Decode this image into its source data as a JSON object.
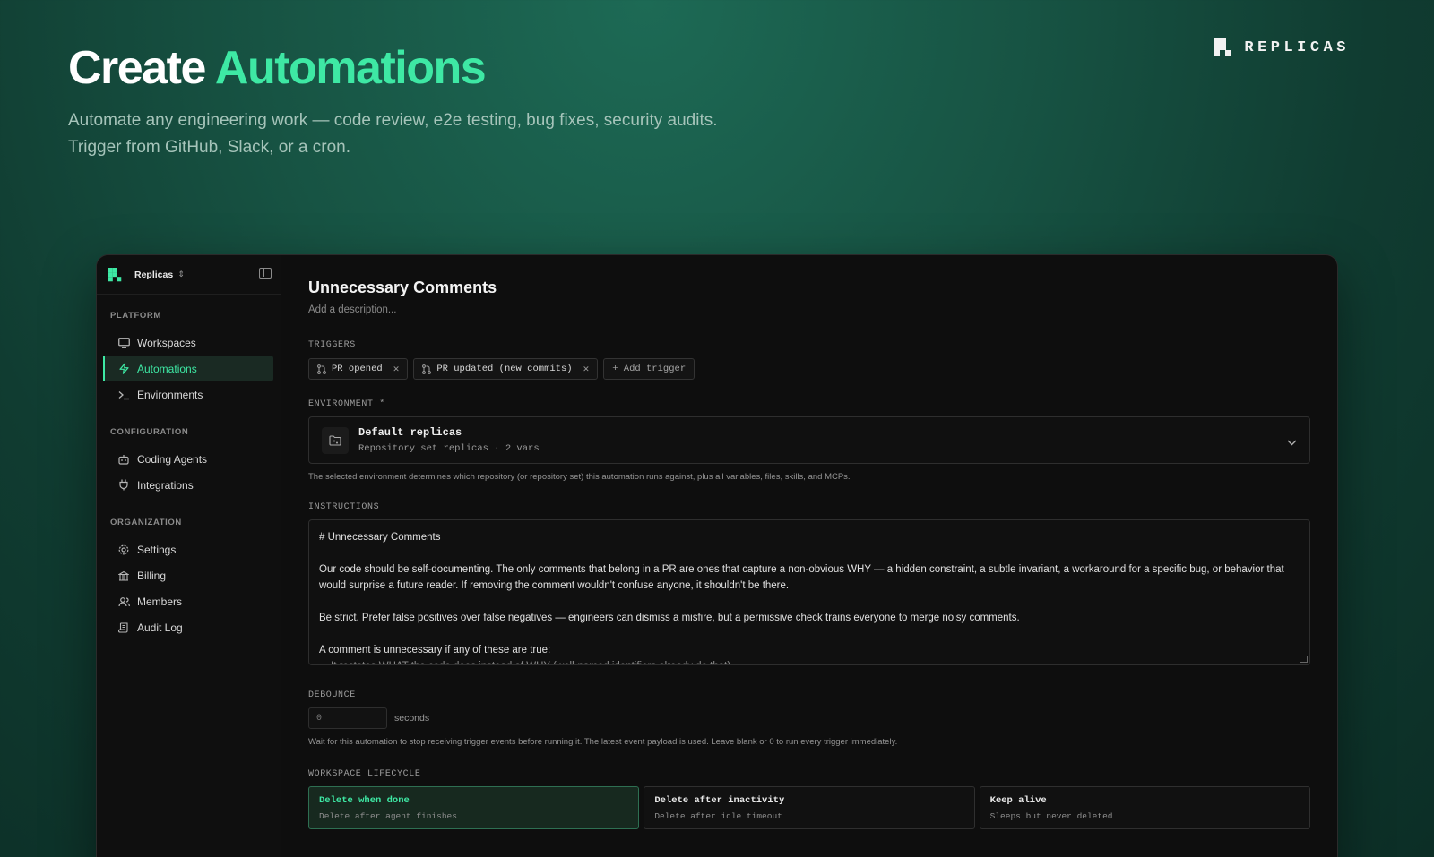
{
  "hero": {
    "title_plain": "Create",
    "title_accent": "Automations",
    "subtitle_line1": "Automate any engineering work — code review, e2e testing, bug fixes, security audits.",
    "subtitle_line2": "Trigger from GitHub, Slack, or a cron."
  },
  "brand": {
    "name": "REPLICAS",
    "logo_icon": "replicas-logo-icon"
  },
  "colors": {
    "accent": "#3ee8a4",
    "background": "#0e0e0e",
    "hero_bg": "#175343"
  },
  "sidebar": {
    "org_name": "Replicas",
    "sections": [
      {
        "label": "PLATFORM",
        "items": [
          {
            "label": "Workspaces",
            "icon": "monitor-icon",
            "active": false
          },
          {
            "label": "Automations",
            "icon": "bolt-icon",
            "active": true
          },
          {
            "label": "Environments",
            "icon": "terminal-icon",
            "active": false
          }
        ]
      },
      {
        "label": "CONFIGURATION",
        "items": [
          {
            "label": "Coding Agents",
            "icon": "bot-icon",
            "active": false
          },
          {
            "label": "Integrations",
            "icon": "plug-icon",
            "active": false
          }
        ]
      },
      {
        "label": "ORGANIZATION",
        "items": [
          {
            "label": "Settings",
            "icon": "gear-icon",
            "active": false
          },
          {
            "label": "Billing",
            "icon": "billing-icon",
            "active": false
          },
          {
            "label": "Members",
            "icon": "users-icon",
            "active": false
          },
          {
            "label": "Audit Log",
            "icon": "scroll-icon",
            "active": false
          }
        ]
      }
    ]
  },
  "main": {
    "title": "Unnecessary Comments",
    "description_placeholder": "Add a description...",
    "triggers_label": "TRIGGERS",
    "triggers": [
      {
        "label": "PR opened",
        "icon": "git-pull-request-icon"
      },
      {
        "label": "PR updated (new commits)",
        "icon": "git-pull-request-icon"
      }
    ],
    "add_trigger_label": "+ Add trigger",
    "environment_label": "ENVIRONMENT *",
    "environment": {
      "name": "Default replicas",
      "meta": "Repository set replicas · 2 vars",
      "help": "The selected environment determines which repository (or repository set) this automation runs against, plus all variables, files, skills, and MCPs."
    },
    "instructions_label": "INSTRUCTIONS",
    "instructions": {
      "heading": "# Unnecessary Comments",
      "para1": "Our code should be self-documenting. The only comments that belong in a PR are ones that capture a non-obvious WHY — a hidden constraint, a subtle invariant, a workaround for a specific bug, or behavior that would surprise a future reader. If removing the comment wouldn't confuse anyone, it shouldn't be there.",
      "para2": "Be strict. Prefer false positives over false negatives — engineers can dismiss a misfire, but a permissive check trains everyone to merge noisy comments.",
      "para3": "A comment is unnecessary if any of these are true:",
      "para4": "- It restates WHAT the code does instead of WHY (well-named identifiers already do that)"
    },
    "debounce_label": "DEBOUNCE",
    "debounce": {
      "placeholder": "0",
      "unit": "seconds",
      "help": "Wait for this automation to stop receiving trigger events before running it. The latest event payload is used. Leave blank or 0 to run every trigger immediately."
    },
    "lifecycle_label": "WORKSPACE LIFECYCLE",
    "lifecycle_options": [
      {
        "name": "Delete when done",
        "desc": "Delete after agent finishes",
        "selected": true
      },
      {
        "name": "Delete after inactivity",
        "desc": "Delete after idle timeout",
        "selected": false
      },
      {
        "name": "Keep alive",
        "desc": "Sleeps but never deleted",
        "selected": false
      }
    ]
  }
}
